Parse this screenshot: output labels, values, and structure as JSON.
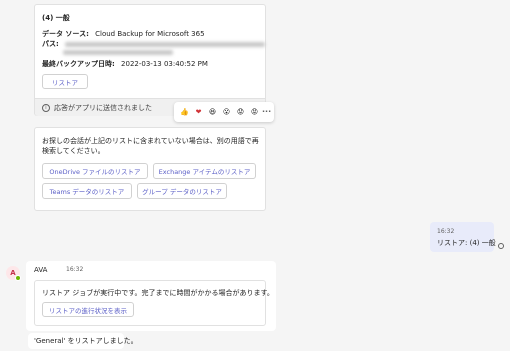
{
  "restore_card": {
    "title": "(4) 一般",
    "source_label": "データ ソース:",
    "source_value": "Cloud Backup for Microsoft 365",
    "path_label": "パス:",
    "backup_label": "最終バックアップ日時:",
    "backup_value": "2022-03-13 03:40:52 PM",
    "restore_button": "リストア",
    "status_text": "応答がアプリに送信されました"
  },
  "reactions": [
    "👍",
    "❤",
    "😆",
    "😮",
    "😟",
    "😡"
  ],
  "more_label": "···",
  "suggest_card": {
    "text": "お探しの会話が上記のリストに含まれていない場合は、別の用語で再検索してください。",
    "buttons": [
      "OneDrive ファイルのリストア",
      "Exchange アイテムのリストア",
      "Teams データのリストア",
      "グループ データのリストア"
    ]
  },
  "user_message": {
    "time": "16:32",
    "text": "リストア: (4) 一般"
  },
  "bot_message": {
    "sender": "AVA",
    "time": "16:32",
    "text": "リストア ジョブが実行中です。完了までに時間がかかる場合があります。",
    "button": "リストアの進行状況を表示"
  },
  "final_message": "'General' をリストアしました。",
  "colors": {
    "accent": "#5b5fc7",
    "user_bubble": "#e8ebfa",
    "online": "#6bb700"
  }
}
